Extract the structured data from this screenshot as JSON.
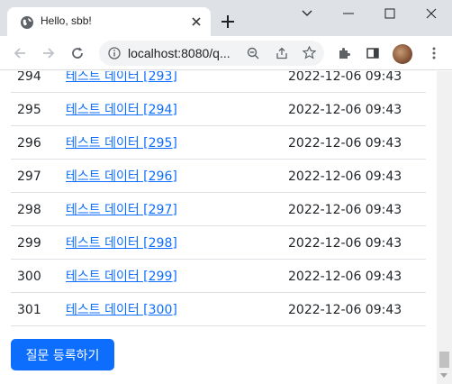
{
  "browser": {
    "tab_title": "Hello, sbb!",
    "url": "localhost:8080/q..."
  },
  "table": {
    "rows": [
      {
        "num": "294",
        "subject": "테스트 데이터 [293]",
        "date": "2022-12-06 09:43"
      },
      {
        "num": "295",
        "subject": "테스트 데이터 [294]",
        "date": "2022-12-06 09:43"
      },
      {
        "num": "296",
        "subject": "테스트 데이터 [295]",
        "date": "2022-12-06 09:43"
      },
      {
        "num": "297",
        "subject": "테스트 데이터 [296]",
        "date": "2022-12-06 09:43"
      },
      {
        "num": "298",
        "subject": "테스트 데이터 [297]",
        "date": "2022-12-06 09:43"
      },
      {
        "num": "299",
        "subject": "테스트 데이터 [298]",
        "date": "2022-12-06 09:43"
      },
      {
        "num": "300",
        "subject": "테스트 데이터 [299]",
        "date": "2022-12-06 09:43"
      },
      {
        "num": "301",
        "subject": "테스트 데이터 [300]",
        "date": "2022-12-06 09:43"
      }
    ]
  },
  "actions": {
    "create_question_label": "질문 등록하기"
  },
  "colors": {
    "link": "#0d6efd",
    "primary": "#0d6efd"
  }
}
